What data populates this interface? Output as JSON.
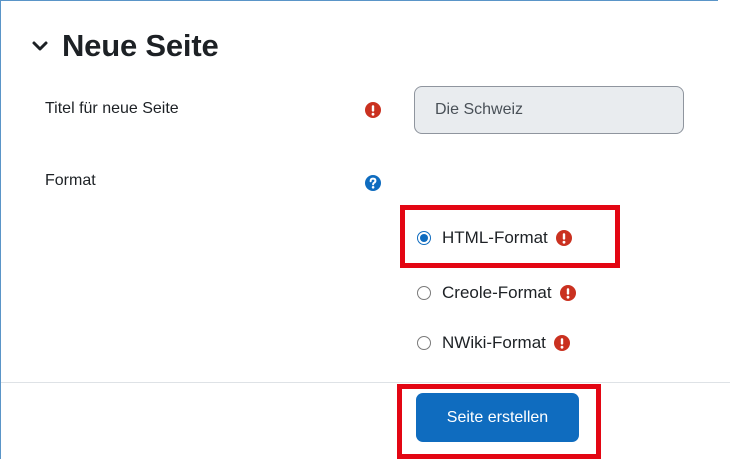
{
  "section": {
    "title": "Neue Seite"
  },
  "form": {
    "title_label": "Titel für neue Seite",
    "title_value": "Die Schweiz",
    "format_label": "Format",
    "format_options": [
      {
        "label": "HTML-Format",
        "selected": true
      },
      {
        "label": "Creole-Format",
        "selected": false
      },
      {
        "label": "NWiki-Format",
        "selected": false
      }
    ],
    "submit_label": "Seite erstellen"
  },
  "colors": {
    "accent": "#0f6cbf",
    "required": "#ca3120",
    "help": "#0f6cbf",
    "highlight": "#e30613"
  }
}
